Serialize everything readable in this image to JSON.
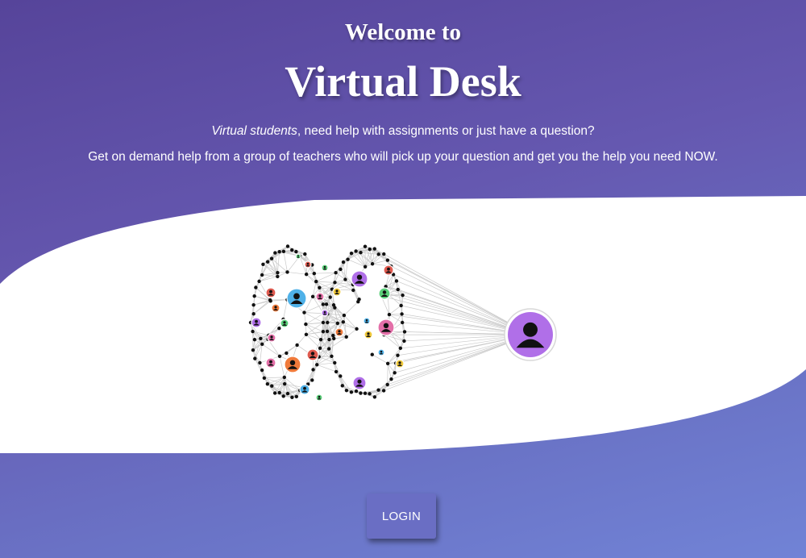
{
  "hero": {
    "welcome": "Welcome to",
    "title": "Virtual Desk",
    "intro_emphasis": "Virtual students",
    "intro_rest": ", need help with assignments or just have a question?",
    "description": "Get on demand help from a group of teachers who will pick up your question and get you the help you need NOW."
  },
  "login_label": "LOGIN",
  "colors": {
    "bg_top": "#56449a",
    "bg_bottom": "#7183d6",
    "hub": "#b06fe8",
    "node_colors": [
      "#e05a4f",
      "#4fb1e8",
      "#5bd07a",
      "#b06fe8",
      "#e36fa8",
      "#f0c93a",
      "#f07a3a"
    ]
  },
  "icons": [
    "user-icon"
  ]
}
